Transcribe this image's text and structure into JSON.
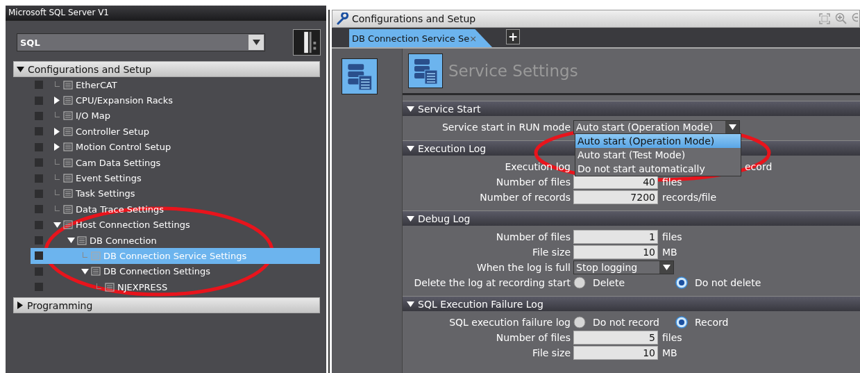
{
  "project": {
    "title": "Microsoft SQL Server V1",
    "device": "SQL"
  },
  "tree": [
    {
      "kind": "header",
      "label": "Configurations and Setup",
      "expanded": true,
      "children": [
        {
          "kind": "leaf",
          "label": "EtherCAT",
          "selected": false
        },
        {
          "kind": "branch",
          "label": "CPU/Expansion Racks",
          "expanded": false,
          "selected": false
        },
        {
          "kind": "leaf",
          "label": "I/O Map",
          "selected": false
        },
        {
          "kind": "branch",
          "label": "Controller Setup",
          "expanded": false,
          "selected": false
        },
        {
          "kind": "branch",
          "label": "Motion Control Setup",
          "expanded": false,
          "selected": false
        },
        {
          "kind": "leaf",
          "label": "Cam Data Settings",
          "selected": false
        },
        {
          "kind": "leaf",
          "label": "Event Settings",
          "selected": false
        },
        {
          "kind": "leaf",
          "label": "Task Settings",
          "selected": false
        },
        {
          "kind": "leaf",
          "label": "Data Trace Settings",
          "selected": false
        },
        {
          "kind": "branch",
          "label": "Host Connection Settings",
          "expanded": true,
          "selected": false,
          "children": [
            {
              "kind": "branch",
              "label": "DB Connection",
              "expanded": true,
              "selected": false,
              "children": [
                {
                  "kind": "leaf",
                  "label": "DB Connection Service Settings",
                  "selected": true
                },
                {
                  "kind": "branch",
                  "label": "DB Connection Settings",
                  "expanded": true,
                  "selected": false,
                  "children": [
                    {
                      "kind": "leaf",
                      "label": "NJEXPRESS",
                      "selected": false
                    }
                  ]
                }
              ]
            }
          ]
        }
      ]
    },
    {
      "kind": "header",
      "label": "Programming",
      "expanded": false
    }
  ],
  "editor": {
    "title": "Configurations and Setup",
    "tabs": [
      {
        "label": "DB Connection Service Se",
        "close": "×",
        "selected": true
      }
    ],
    "add_tab": "+",
    "page_title": "Service Settings",
    "sections": [
      {
        "title": "Service Start",
        "expanded": true,
        "rows": [
          {
            "kind": "select",
            "label": "Service start in RUN mode",
            "value": "Auto start (Operation Mode)",
            "expanded": true,
            "options": [
              {
                "label": "Auto start (Operation Mode)",
                "selected": true
              },
              {
                "label": "Auto start (Test Mode)",
                "selected": false
              },
              {
                "label": "Do not start automatically",
                "selected": false
              }
            ]
          }
        ]
      },
      {
        "title": "Execution Log",
        "expanded": true,
        "rows": [
          {
            "kind": "covered",
            "label": "Execution log",
            "tail": "ecord"
          },
          {
            "kind": "number",
            "label": "Number of files",
            "value": "40",
            "unit": "files"
          },
          {
            "kind": "number",
            "label": "Number of records",
            "value": "7200",
            "unit": "records/file"
          }
        ]
      },
      {
        "title": "Debug Log",
        "expanded": true,
        "rows": [
          {
            "kind": "number",
            "label": "Number of files",
            "value": "1",
            "unit": "files"
          },
          {
            "kind": "number",
            "label": "File size",
            "value": "10",
            "unit": "MB"
          },
          {
            "kind": "select",
            "label": "When the log is full",
            "value": "Stop logging",
            "expanded": false
          },
          {
            "kind": "radio",
            "label": "Delete the log at recording start",
            "options": [
              {
                "label": "Delete",
                "selected": false
              },
              {
                "label": "Do not delete",
                "selected": true
              }
            ]
          }
        ]
      },
      {
        "title": "SQL Execution Failure Log",
        "expanded": true,
        "rows": [
          {
            "kind": "radio",
            "label": "SQL execution failure log",
            "options": [
              {
                "label": "Do not record",
                "selected": false
              },
              {
                "label": "Record",
                "selected": true
              }
            ]
          },
          {
            "kind": "number",
            "label": "Number of files",
            "value": "5",
            "unit": "files"
          },
          {
            "kind": "number",
            "label": "File size",
            "value": "10",
            "unit": "MB"
          }
        ]
      }
    ]
  }
}
